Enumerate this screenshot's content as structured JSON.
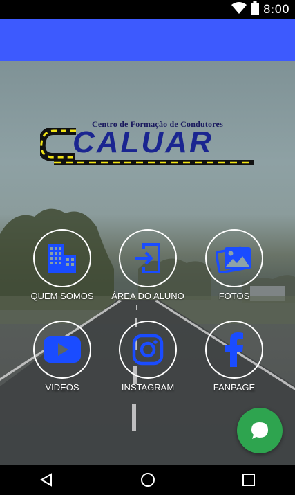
{
  "status_bar": {
    "time": "8:00",
    "icons": [
      "wifi-icon",
      "battery-icon"
    ]
  },
  "app_bar": {
    "color": "#3d5afe"
  },
  "logo": {
    "subtitle": "Centro de Formação de Condutores",
    "title": "CALUAR"
  },
  "menu": {
    "quem_somos": {
      "label": "QUEM SOMOS",
      "icon": "building-icon"
    },
    "area_aluno": {
      "label": "ÁREA DO ALUNO",
      "icon": "login-icon"
    },
    "fotos": {
      "label": "FOTOS",
      "icon": "photos-icon"
    },
    "videos": {
      "label": "VIDEOS",
      "icon": "youtube-icon"
    },
    "instagram": {
      "label": "INSTAGRAM",
      "icon": "instagram-icon"
    },
    "fanpage": {
      "label": "FANPAGE",
      "icon": "facebook-icon"
    }
  },
  "colors": {
    "icon_blue": "#1a4cff",
    "fab_green": "#2ea44f"
  },
  "fab": {
    "icon": "chat-icon"
  },
  "nav_bar": {
    "icons": [
      "back-icon",
      "home-icon",
      "recents-icon"
    ]
  }
}
